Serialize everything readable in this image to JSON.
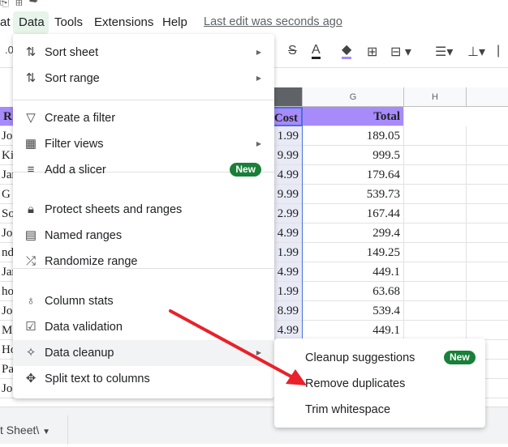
{
  "menubar": {
    "items": [
      "at",
      "Data",
      "Tools",
      "Extensions",
      "Help"
    ],
    "last_edit": "Last edit was seconds ago"
  },
  "toolbar": {
    "icons": [
      "strikethrough-icon",
      "text-color-icon",
      "fill-color-icon",
      "borders-icon",
      "merge-cells-icon",
      "align-icon",
      "vertical-align-icon"
    ],
    "fill_color": "#a78bfa"
  },
  "columns": [
    "G",
    "H"
  ],
  "sheet": {
    "header": {
      "left": "R",
      "cost": "Cost",
      "total": "Total"
    },
    "left": [
      "Jo",
      "Ki",
      "Jar",
      "G",
      "Sor",
      "Jo",
      "nd",
      "Jar",
      "hor",
      "Jo",
      "Mo",
      "Ho",
      "Pa",
      "Jo"
    ],
    "cost": [
      "1.99",
      "9.99",
      "4.99",
      "9.99",
      "2.99",
      "4.99",
      "1.99",
      "4.99",
      "1.99",
      "8.99",
      "4.99"
    ],
    "total": [
      "189.05",
      "999.5",
      "179.64",
      "539.73",
      "167.44",
      "299.4",
      "149.25",
      "449.1",
      "63.68",
      "539.4",
      "449.1"
    ],
    "header_color": "#a78bfa"
  },
  "menu": {
    "items": [
      {
        "label": "Sort sheet",
        "icon": "sort-icon",
        "sub": true
      },
      {
        "label": "Sort range",
        "icon": "sort-icon",
        "sub": true
      },
      {
        "label": "Create a filter",
        "icon": "filter-icon"
      },
      {
        "label": "Filter views",
        "icon": "filter-views-icon",
        "sub": true
      },
      {
        "label": "Add a slicer",
        "icon": "slicer-icon",
        "badge": "New"
      },
      {
        "label": "Protect sheets and ranges",
        "icon": "lock-icon"
      },
      {
        "label": "Named ranges",
        "icon": "named-ranges-icon"
      },
      {
        "label": "Randomize range",
        "icon": "shuffle-icon"
      },
      {
        "label": "Column stats",
        "icon": "lightbulb-icon"
      },
      {
        "label": "Data validation",
        "icon": "data-validation-icon"
      },
      {
        "label": "Data cleanup",
        "icon": "magic-wand-icon",
        "sub": true
      },
      {
        "label": "Split text to columns",
        "icon": "split-icon"
      }
    ]
  },
  "submenu": {
    "items": [
      "Cleanup suggestions",
      "Remove duplicates",
      "Trim whitespace"
    ],
    "badge": "New"
  },
  "sheet_tab": {
    "label": "t Sheet\\"
  },
  "colors": {
    "accent": "#188038",
    "arrow": "#e8212b"
  }
}
